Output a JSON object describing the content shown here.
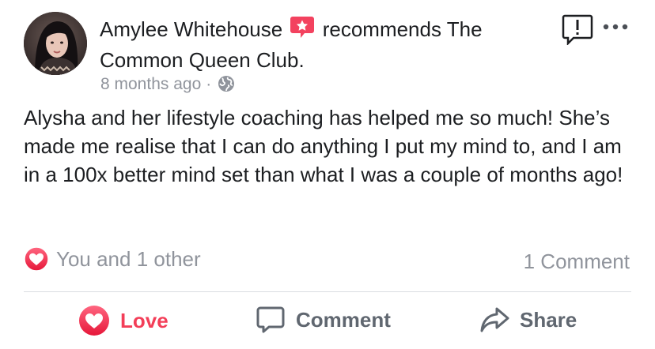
{
  "post": {
    "author": "Amylee Whitehouse",
    "verb": "recommends",
    "page_name": "The Common Queen Club.",
    "timestamp": "8 months ago",
    "separator": "·",
    "privacy_icon": "globe-icon",
    "recommend_icon": "recommend-star-icon",
    "text": "Alysha and her lifestyle coaching has helped me so much! She’s made me realise that I can do anything I put my mind to, and I am in a 100x better mind set than what I was a couple of months ago!"
  },
  "header_actions": {
    "report_icon": "report-icon",
    "more_icon": "more-options-icon"
  },
  "engagement": {
    "reaction_icon": "love-reaction-icon",
    "reactions_label": "You and 1 other",
    "comments_label": "1 Comment"
  },
  "actions": {
    "love_label": "Love",
    "comment_label": "Comment",
    "share_label": "Share"
  },
  "colors": {
    "love": "#f33e58",
    "muted_text": "#90949c",
    "action_text": "#606770",
    "primary_text": "#1c1e21",
    "divider": "#dadde1"
  }
}
